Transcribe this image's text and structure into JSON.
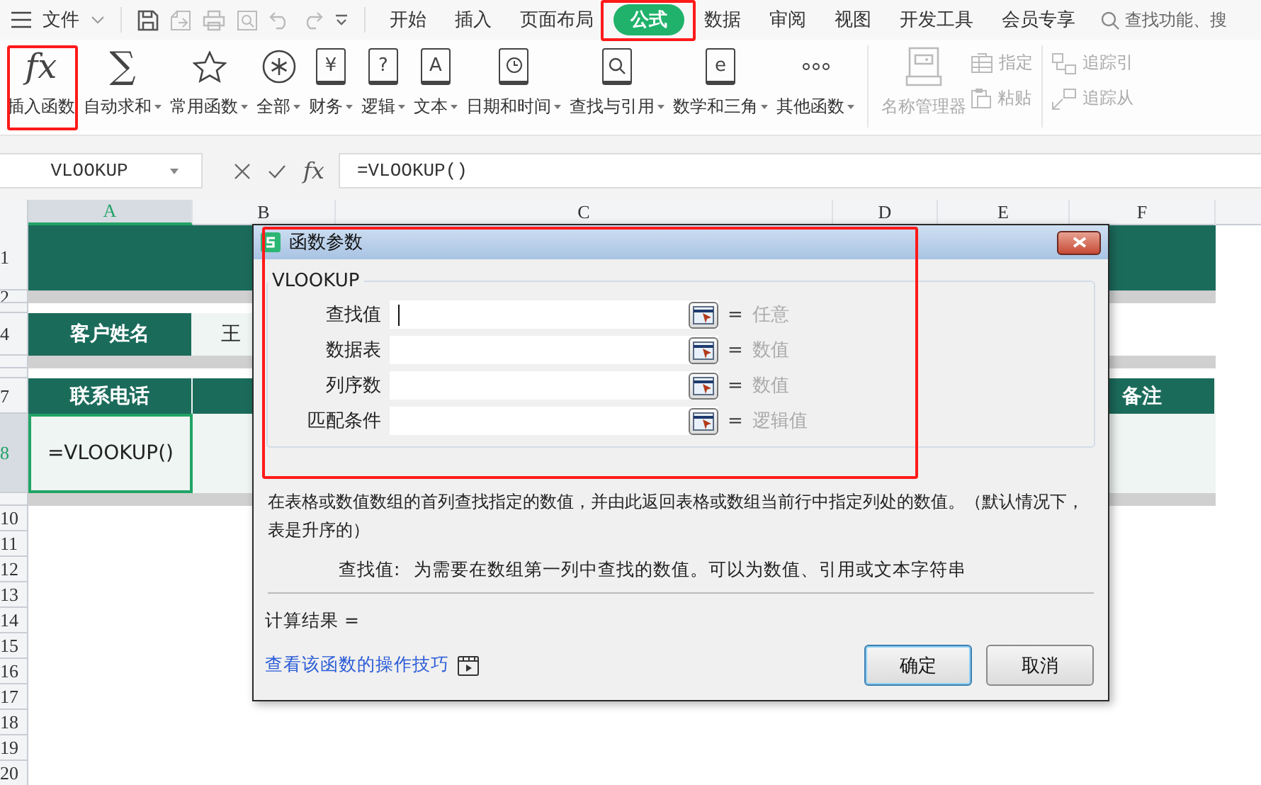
{
  "menu_bar": {
    "file_menu": "文件",
    "tabs": [
      {
        "label": "开始",
        "selected": false
      },
      {
        "label": "插入",
        "selected": false
      },
      {
        "label": "页面布局",
        "selected": false
      },
      {
        "label": "公式",
        "selected": true
      },
      {
        "label": "数据",
        "selected": false
      },
      {
        "label": "审阅",
        "selected": false
      },
      {
        "label": "视图",
        "selected": false
      },
      {
        "label": "开发工具",
        "selected": false
      },
      {
        "label": "会员专享",
        "selected": false
      }
    ],
    "search": {
      "placeholder": "查找功能、搜"
    }
  },
  "ribbon": {
    "buttons": [
      {
        "label": "插入函数",
        "kind": "glyph",
        "glyph": "fx",
        "caret": false
      },
      {
        "label": "自动求和",
        "kind": "glyph",
        "glyph": "∑",
        "caret": true
      },
      {
        "label": "常用函数",
        "kind": "star",
        "caret": true
      },
      {
        "label": "全部",
        "kind": "asterisk",
        "caret": true
      },
      {
        "label": "财务",
        "kind": "book",
        "glyph": "¥",
        "caret": true
      },
      {
        "label": "逻辑",
        "kind": "book",
        "glyph": "?",
        "caret": true
      },
      {
        "label": "文本",
        "kind": "book",
        "glyph": "A",
        "caret": true
      },
      {
        "label": "日期和时间",
        "kind": "book-clock",
        "caret": true
      },
      {
        "label": "查找与引用",
        "kind": "book-search",
        "caret": true
      },
      {
        "label": "数学和三角",
        "kind": "book",
        "glyph": "e",
        "caret": true
      },
      {
        "label": "其他函数",
        "kind": "dots",
        "caret": true
      }
    ],
    "name_manager": {
      "label": "名称管理器",
      "disabled": true
    },
    "small_buttons": [
      {
        "label": "指定",
        "kind": "table",
        "disabled": true
      },
      {
        "label": "粘贴",
        "kind": "clipboard",
        "disabled": true
      }
    ],
    "trace_buttons": [
      {
        "label": "追踪引",
        "kind": "trace-in",
        "disabled": true
      },
      {
        "label": "追踪从",
        "kind": "trace-out",
        "disabled": true
      }
    ]
  },
  "formula_bar": {
    "name_box": "VLOOKUP",
    "fx": "fx",
    "formula": "=VLOOKUP()"
  },
  "sheet": {
    "columns": [
      {
        "label": "A",
        "selected": true
      },
      {
        "label": "B",
        "selected": false
      },
      {
        "label": "C",
        "selected": false
      },
      {
        "label": "D",
        "selected": false
      },
      {
        "label": "E",
        "selected": false
      },
      {
        "label": "F",
        "selected": false
      }
    ],
    "rows": [
      {
        "number": "1",
        "kind": "title",
        "selected": false
      },
      {
        "number": "2",
        "kind": "gray",
        "selected": false
      },
      {
        "kind": "gap",
        "selected": false
      },
      {
        "number": "4",
        "kind": "field",
        "selected": false,
        "cells": [
          {
            "kind": "header",
            "text": "客户姓名"
          },
          {
            "kind": "value",
            "text": "王"
          },
          {
            "kind": "blank"
          },
          {
            "kind": "blank"
          },
          {
            "kind": "blank"
          },
          {
            "kind": "blank"
          }
        ]
      },
      {
        "kind": "gray",
        "selected": false
      },
      {
        "kind": "gap",
        "selected": false
      },
      {
        "number": "7",
        "kind": "header",
        "selected": false,
        "cells": [
          {
            "kind": "header",
            "text": "联系电话"
          },
          {
            "kind": "header"
          },
          {
            "kind": "blank"
          },
          {
            "kind": "blank"
          },
          {
            "kind": "blank"
          },
          {
            "kind": "header",
            "text": "备注"
          }
        ]
      },
      {
        "number": "8",
        "kind": "data",
        "selected": true,
        "cells": [
          {
            "kind": "selected",
            "text": "=VLOOKUP()"
          },
          {
            "kind": "value"
          },
          {
            "kind": "blank"
          },
          {
            "kind": "blank"
          },
          {
            "kind": "blank"
          },
          {
            "kind": "value"
          }
        ]
      },
      {
        "kind": "gray",
        "selected": false
      },
      {
        "number": "10",
        "kind": "empty",
        "selected": false
      },
      {
        "number": "11",
        "kind": "empty",
        "selected": false
      },
      {
        "number": "12",
        "kind": "empty",
        "selected": false
      },
      {
        "number": "13",
        "kind": "empty",
        "selected": false
      },
      {
        "number": "14",
        "kind": "empty",
        "selected": false
      },
      {
        "number": "15",
        "kind": "empty",
        "selected": false
      },
      {
        "number": "16",
        "kind": "empty",
        "selected": false
      },
      {
        "number": "17",
        "kind": "empty",
        "selected": false
      },
      {
        "number": "18",
        "kind": "empty",
        "selected": false
      },
      {
        "number": "19",
        "kind": "empty",
        "selected": false
      },
      {
        "number": "20",
        "kind": "empty",
        "selected": false
      }
    ]
  },
  "dialog": {
    "title": "函数参数",
    "function": "VLOOKUP",
    "arguments": [
      {
        "label": "查找值",
        "equals": "=",
        "hint": "任意",
        "focused": true
      },
      {
        "label": "数据表",
        "equals": "=",
        "hint": "数值",
        "focused": false
      },
      {
        "label": "列序数",
        "equals": "=",
        "hint": "数值",
        "focused": false
      },
      {
        "label": "匹配条件",
        "equals": "=",
        "hint": "逻辑值",
        "focused": false
      }
    ],
    "description": "在表格或数值数组的首列查找指定的数值，并由此返回表格或数组当前行中指定列处的数值。（默认情况下，表是升序的）",
    "argument_help": {
      "label": "查找值:",
      "text": "为需要在数组第一列中查找的数值。可以为数值、引用或文本字符串"
    },
    "result": "计算结果  =",
    "help_link": "查看该函数的操作技巧",
    "buttons": [
      {
        "label": "确定",
        "default": true
      },
      {
        "label": "取消",
        "default": false
      }
    ]
  }
}
